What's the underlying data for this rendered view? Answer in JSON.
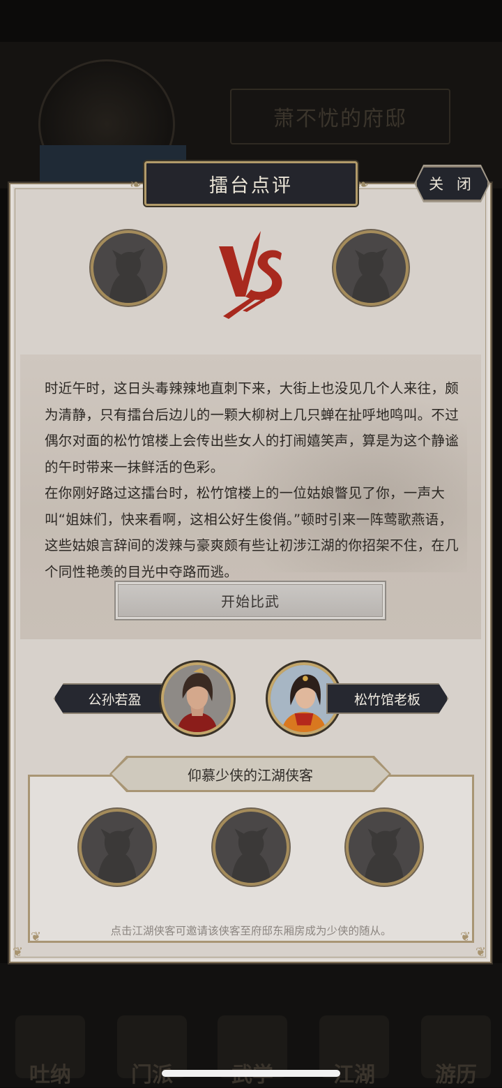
{
  "background": {
    "mansion_title": "萧不忧的府邸",
    "nav": [
      "吐纳",
      "门派",
      "武学",
      "江湖",
      "游历"
    ]
  },
  "modal": {
    "title": "擂台点评",
    "close_label": "关 闭",
    "vs_label": "VS",
    "story_paragraphs": [
      "时近午时，这日头毒辣辣地直刺下来，大街上也没见几个人来往，颇为清静，只有擂台后边儿的一颗大柳树上几只蝉在扯呼地鸣叫。不过偶尔对面的松竹馆楼上会传出些女人的打闹嬉笑声，算是为这个静谧的午时带来一抹鲜活的色彩。",
      "在你刚好路过这擂台时，松竹馆楼上的一位姑娘瞥见了你，一声大叫“姐妹们，快来看啊，这相公好生俊俏。”顿时引来一阵莺歌燕语，这些姑娘言辞间的泼辣与豪爽颇有些让初涉江湖的你招架不住，在几个同性艳羡的目光中夺路而逃。"
    ],
    "start_button": "开始比武",
    "characters": [
      {
        "name": "公孙若盈"
      },
      {
        "name": "松竹馆老板"
      }
    ],
    "followers": {
      "header": "仰慕少侠的江湖侠客",
      "hint": "点击江湖侠客可邀请该侠客至府邸东厢房成为少侠的随从。"
    }
  },
  "colors": {
    "panel": "#d7d1cb",
    "plate": "#24252c",
    "gold": "#b29b6a",
    "vs_red": "#a8291e"
  }
}
